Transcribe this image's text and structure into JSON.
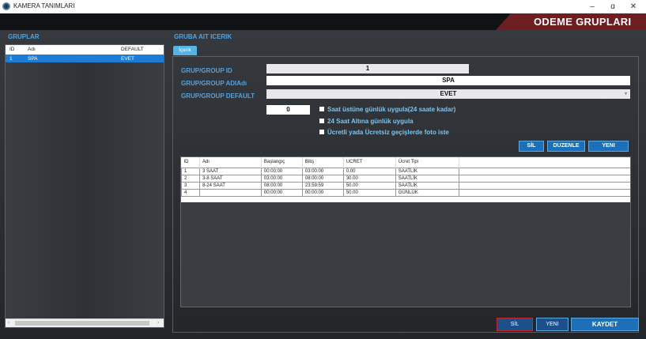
{
  "window": {
    "title": "KAMERA TANIMLARI",
    "controls": [
      "–",
      "ɑ",
      "✕"
    ]
  },
  "header": {
    "banner": "ODEME GRUPLARI"
  },
  "groups": {
    "title": "GRUPLAR",
    "columns": [
      "ID",
      "Adı",
      "DEFAULT"
    ],
    "rows": [
      {
        "id": "1",
        "name": "SPA",
        "default": "EVET"
      }
    ]
  },
  "content": {
    "title": "GRUBA AIT ICERIK",
    "tab": "İçerik",
    "fields": {
      "group_id_label": "GRUP/GROUP ID",
      "group_id_value": "1",
      "group_name_label": "GRUP/GROUP ADIAdı",
      "group_name_value": "SPA",
      "group_default_label": "GRUP/GROUP DEFAULT",
      "group_default_value": "EVET",
      "hours_value": "0"
    },
    "checkboxes": [
      "Saat üstüne günlük uygula(24 saate kadar)",
      "24 Saat Altına günlük uygula",
      "Ücretli yada Ücretsiz geçişlerde foto iste"
    ],
    "actions": {
      "delete": "SİL",
      "edit": "DUZENLE",
      "new": "YENI"
    },
    "table": {
      "columns": [
        "ID",
        "Adı",
        "Başlangıç",
        "Bitiş",
        "UCRET",
        "Ücret Tipi"
      ],
      "rows": [
        [
          "1",
          "3 SAAT",
          "00:00:00",
          "03:00:00",
          "0.00",
          "SAATLİK"
        ],
        [
          "2",
          "3-8 SAAT",
          "03:00:00",
          "08:00:00",
          "30.00",
          "SAATLİK"
        ],
        [
          "3",
          "8-24 SAAT",
          "08:00:00",
          "23:59:59",
          "50.00",
          "SAATLİK"
        ],
        [
          "4",
          "",
          "00:00:00",
          "00:00:00",
          "50.00",
          "GÜNLÜK"
        ]
      ]
    }
  },
  "footer": {
    "delete": "SİL",
    "new": "YENI",
    "save": "KAYDET"
  },
  "colors": {
    "accent": "#4fa3e0",
    "selection": "#1c7dd6",
    "banner": "#6e1d21",
    "delete_border": "#c0282e"
  }
}
